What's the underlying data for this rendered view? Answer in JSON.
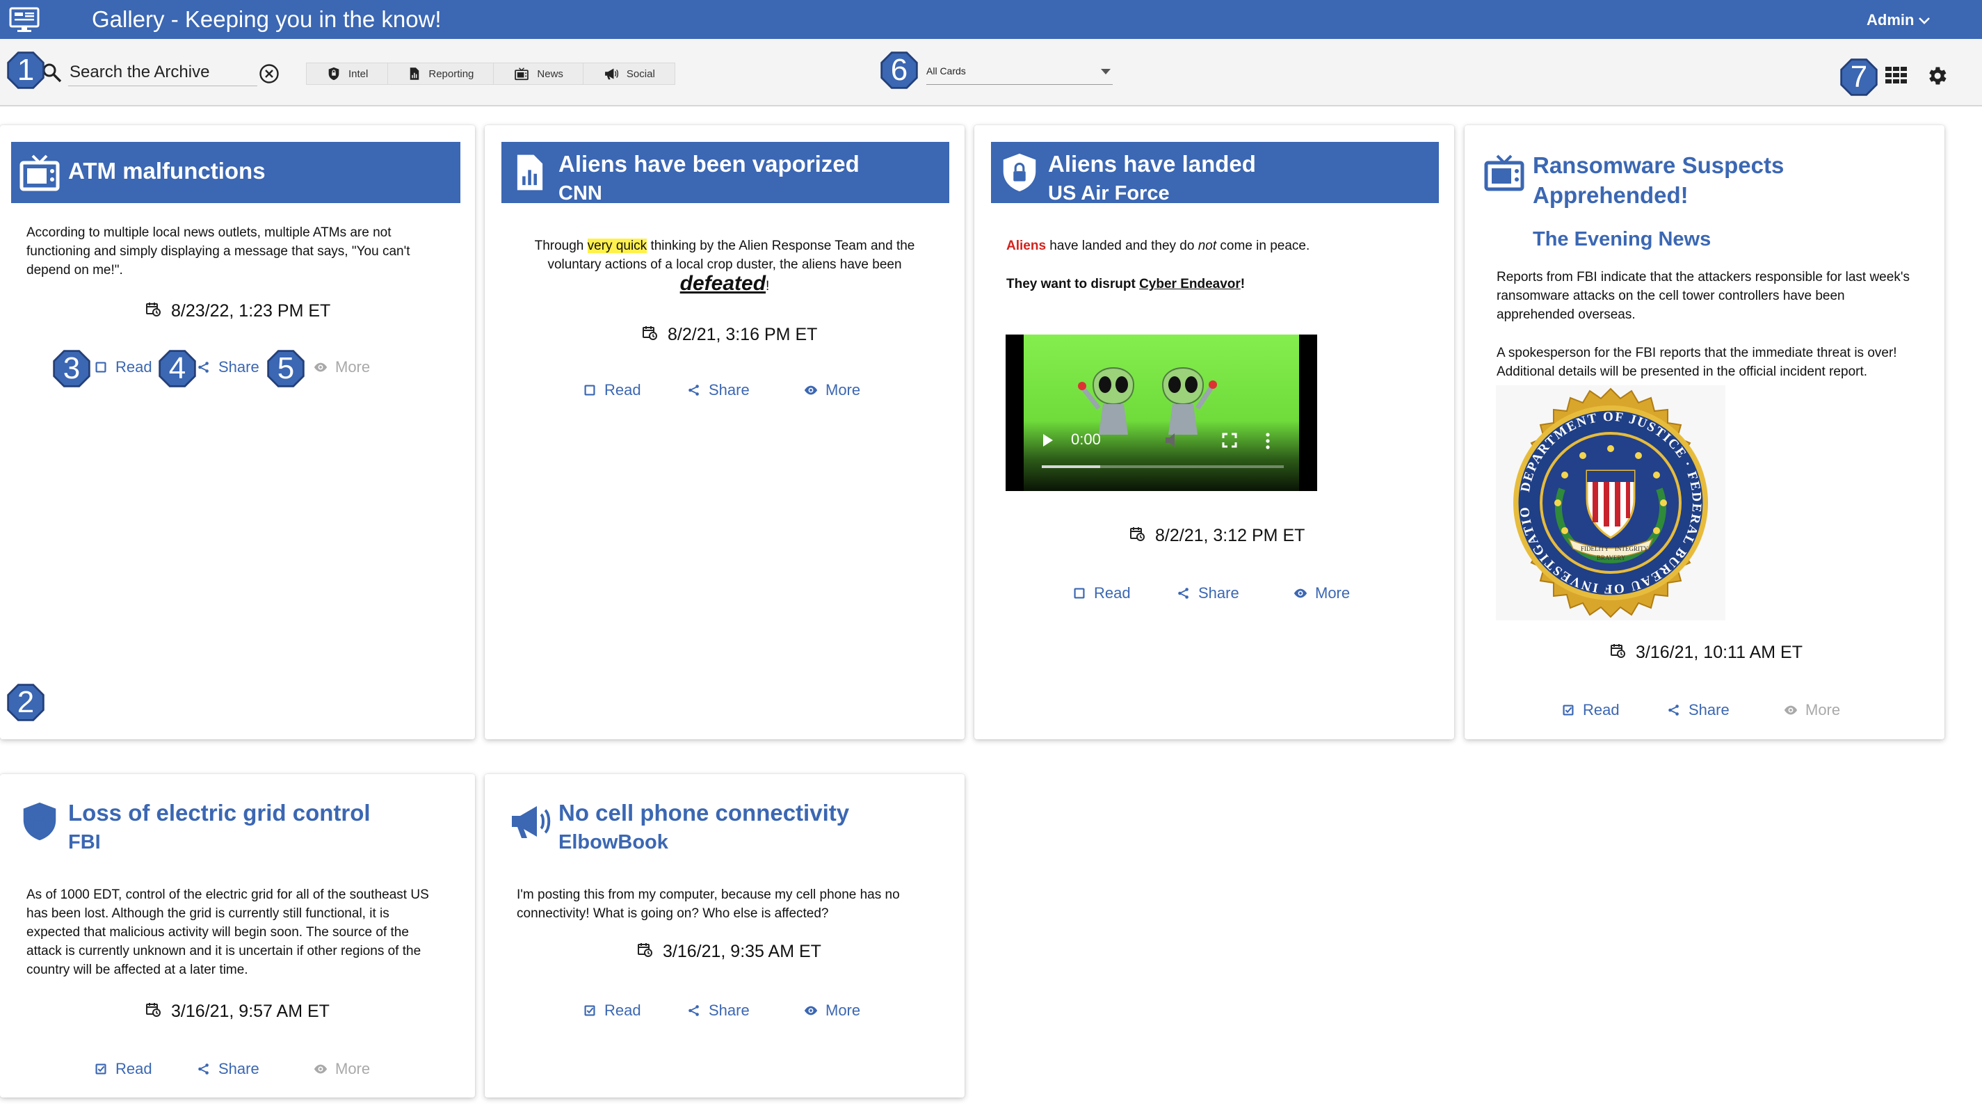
{
  "app": {
    "title": "Gallery - Keeping you in the know!",
    "user": "Admin"
  },
  "search": {
    "placeholder": "Search the Archive"
  },
  "filters": [
    {
      "label": "Intel",
      "icon": "shield-icon"
    },
    {
      "label": "Reporting",
      "icon": "document-chart-icon"
    },
    {
      "label": "News",
      "icon": "tv-icon"
    },
    {
      "label": "Social",
      "icon": "megaphone-icon"
    }
  ],
  "card_filter": {
    "selected": "All Cards"
  },
  "badges": [
    "1",
    "2",
    "3",
    "4",
    "5",
    "6",
    "7"
  ],
  "actions": {
    "read": "Read",
    "share": "Share",
    "more": "More"
  },
  "colors": {
    "primary": "#3b67b3",
    "highlight": "#fff14d",
    "alert": "#d4221d",
    "disabled": "#a9a9a9"
  },
  "cards": [
    {
      "title": "ATM malfunctions",
      "source": "",
      "icon": "tv-icon",
      "body": "According to multiple local news outlets, multiple ATMs are not functioning and simply displaying a message that says, \"You can't depend on me!\".",
      "date": "8/23/22, 1:23 PM ET",
      "more_enabled": false
    },
    {
      "title": "Aliens have been vaporized",
      "source": "CNN",
      "icon": "document-chart-icon",
      "body_parts": [
        "Through ",
        "very quick",
        " thinking by the Alien Response Team and the voluntary actions of a local crop duster, the aliens have been ",
        "defeated",
        "!"
      ],
      "date": "8/2/21, 3:16 PM ET",
      "more_enabled": true
    },
    {
      "title": "Aliens have landed",
      "source": "US Air Force",
      "icon": "shield-lock-icon",
      "body_parts": [
        "Aliens",
        " have landed and they do ",
        "not",
        " come in peace.",
        "They want to disrupt ",
        "Cyber Endeavor",
        "!"
      ],
      "video_time": "0:00",
      "date": "8/2/21, 3:12 PM ET",
      "more_enabled": true
    },
    {
      "title": "Ransomware Suspects Apprehended!",
      "source": "The Evening News",
      "icon": "tv-icon",
      "body": "Reports from FBI indicate that the attackers responsible for last week's ransomware attacks on the cell tower controllers have been apprehended overseas.",
      "body2": "A spokesperson for the FBI reports that the immediate threat is over! Additional details will be presented in the official incident report.",
      "seal_text": "DEPARTMENT OF JUSTICE · FEDERAL BUREAU OF INVESTIGATION",
      "seal_motto": [
        "FIDELITY",
        "BRAVERY",
        "INTEGRITY"
      ],
      "date": "3/16/21, 10:11 AM ET",
      "more_enabled": false
    },
    {
      "title": "Loss of electric grid control",
      "source": "FBI",
      "icon": "shield-lock-icon",
      "body": "As of 1000 EDT, control of the electric grid for all of the southeast US has been lost. Although the grid is currently still functional, it is expected that malicious activity will begin soon.  The source of the attack is currently unknown and it is uncertain if other regions of the country will be affected at a later time.",
      "date": "3/16/21, 9:57 AM ET",
      "more_enabled": false
    },
    {
      "title": "No cell phone connectivity",
      "source": "ElbowBook",
      "icon": "megaphone-icon",
      "body": "I'm posting this from my computer, because my cell phone has no connectivity!  What is going on?  Who else is affected?",
      "date": "3/16/21, 9:35 AM ET",
      "more_enabled": true
    }
  ]
}
